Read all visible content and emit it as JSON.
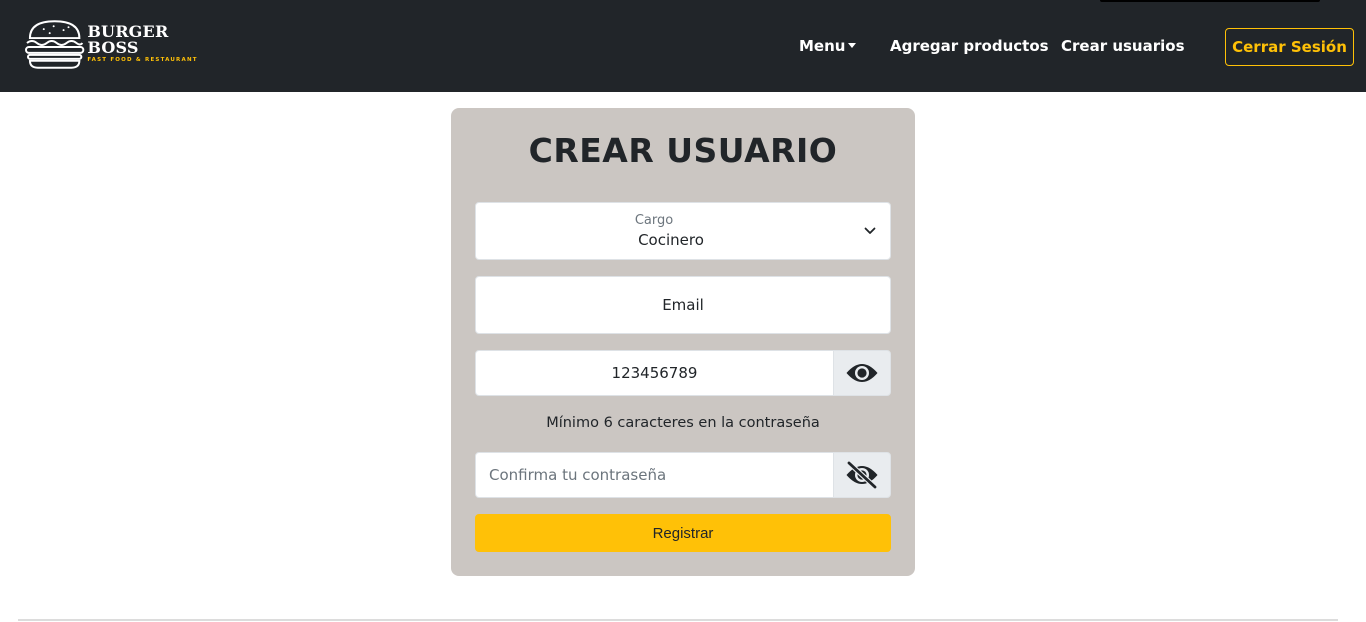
{
  "brand": {
    "name": "BURGER BOSS",
    "tagline": "FAST FOOD & RESTAURANT",
    "logo_icon": "burger-icon"
  },
  "nav": {
    "menu_label": "Menu",
    "add_products_label": "Agregar productos",
    "create_users_label": "Crear usuarios",
    "logout_label": "Cerrar Sesión"
  },
  "form": {
    "title": "CREAR USUARIO",
    "role": {
      "label": "Cargo",
      "value": "Cocinero"
    },
    "email": {
      "placeholder": "Email"
    },
    "password": {
      "value": "123456789",
      "toggle_icon": "eye-icon"
    },
    "hint": "Mínimo 6 caracteres en la contraseña",
    "confirm": {
      "placeholder": "Confirma tu contraseña",
      "toggle_icon": "eye-slash-icon"
    },
    "submit_label": "Registrar"
  },
  "colors": {
    "navbar": "#212529",
    "accent": "#ffc107",
    "card": "#cbc6c2"
  }
}
